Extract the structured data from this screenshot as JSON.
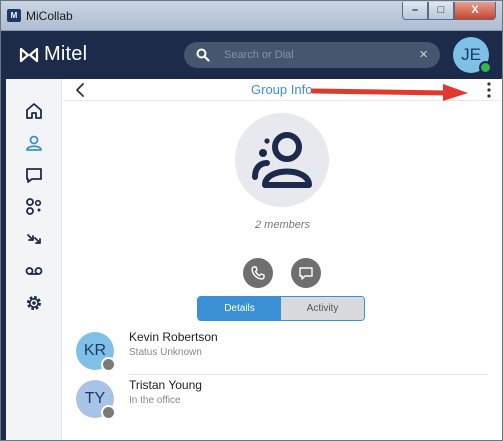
{
  "window": {
    "title": "MiCollab",
    "app_icon_text": "M",
    "minimize": "–",
    "maximize": "□",
    "close": "X"
  },
  "header": {
    "logo_text": "Mitel",
    "search": {
      "placeholder": "Search or Dial",
      "value": ""
    },
    "clear_glyph": "×",
    "user_initials": "JE",
    "user_presence_color": "#37b24d"
  },
  "sidebar": {
    "items": [
      {
        "icon": "home-icon"
      },
      {
        "icon": "contacts-icon",
        "active": true
      },
      {
        "icon": "chat-icon"
      },
      {
        "icon": "people-icon"
      },
      {
        "icon": "call-history-icon"
      },
      {
        "icon": "voicemail-icon"
      },
      {
        "icon": "settings-icon"
      }
    ]
  },
  "subheader": {
    "title": "Group Info"
  },
  "group": {
    "members_text": "2 members",
    "tabs": [
      {
        "label": "Details",
        "active": true
      },
      {
        "label": "Activity",
        "active": false
      }
    ]
  },
  "members": [
    {
      "initials": "KR",
      "name": "Kevin Robertson",
      "status": "Status Unknown",
      "avatar_color": "#7ec0e8"
    },
    {
      "initials": "TY",
      "name": "Tristan Young",
      "status": "In the office",
      "avatar_color": "#a9c3e6"
    }
  ],
  "colors": {
    "accent": "#3b8fd4",
    "header": "#1c2b4a",
    "annotation_arrow": "#e03a2f"
  }
}
